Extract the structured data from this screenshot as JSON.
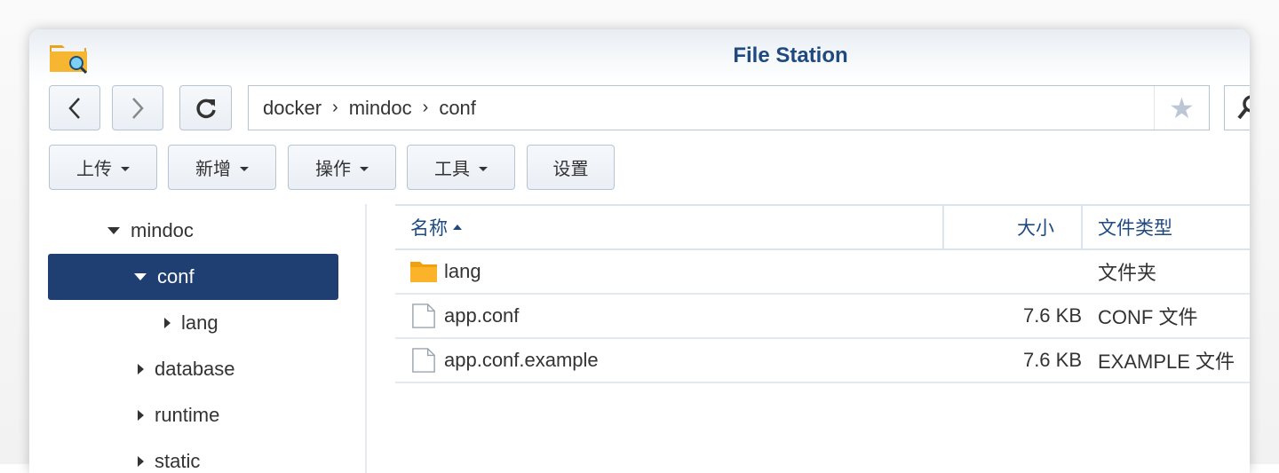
{
  "window": {
    "title": "File Station"
  },
  "nav": {
    "path": [
      "docker",
      "mindoc",
      "conf"
    ]
  },
  "toolbar": {
    "upload": "上传",
    "create": "新增",
    "action": "操作",
    "tools": "工具",
    "settings": "设置"
  },
  "tree": [
    {
      "label": "mindoc",
      "expanded": true
    },
    {
      "label": "conf",
      "expanded": true,
      "selected": true
    },
    {
      "label": "lang",
      "expanded": false
    },
    {
      "label": "database",
      "expanded": false
    },
    {
      "label": "runtime",
      "expanded": false
    },
    {
      "label": "static",
      "expanded": false
    }
  ],
  "table": {
    "headers": {
      "name": "名称",
      "size": "大小",
      "type": "文件类型"
    },
    "rows": [
      {
        "name": "lang",
        "size": "",
        "type": "文件夹",
        "icon": "folder-icon"
      },
      {
        "name": "app.conf",
        "size": "7.6 KB",
        "type": "CONF 文件",
        "icon": "file-icon"
      },
      {
        "name": "app.conf.example",
        "size": "7.6 KB",
        "type": "EXAMPLE 文件",
        "icon": "file-icon"
      }
    ]
  },
  "colors": {
    "accent": "#1f3f73",
    "title": "#1f4a80"
  }
}
